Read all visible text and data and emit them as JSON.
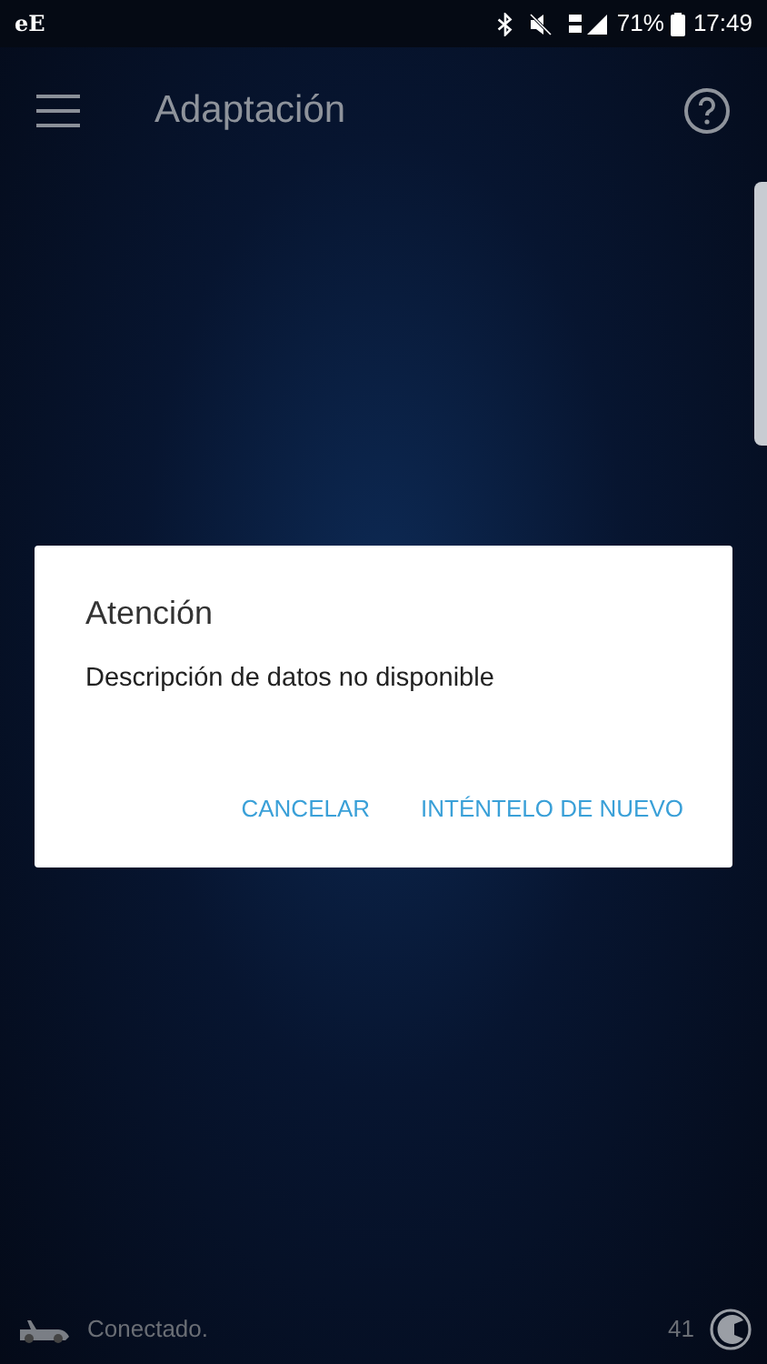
{
  "status_bar": {
    "carrier": "eE",
    "battery": "71%",
    "time": "17:49"
  },
  "app_bar": {
    "title": "Adaptación"
  },
  "dialog": {
    "title": "Atención",
    "message": "Descripción de datos no disponible",
    "buttons": [
      "CANCELAR",
      "INTÉNTELO DE NUEVO"
    ]
  },
  "footer": {
    "status": "Conectado.",
    "count": "41"
  }
}
